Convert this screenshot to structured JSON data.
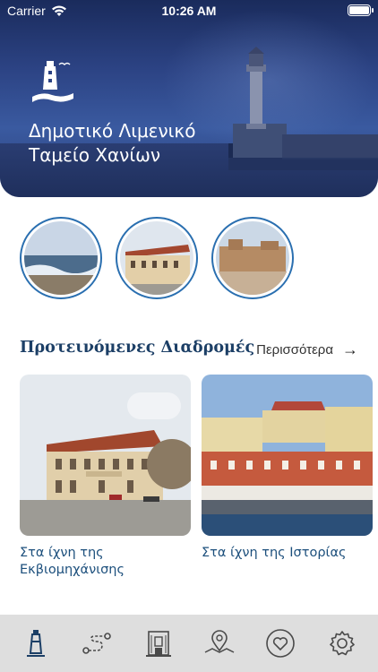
{
  "status_bar": {
    "carrier": "Carrier",
    "time": "10:26 AM"
  },
  "hero": {
    "title_line1": "Δημοτικό Λιμενικό",
    "title_line2": "Ταμείο Χανίων"
  },
  "circles": [
    {
      "name": "harbor-waves-photo"
    },
    {
      "name": "building-photo"
    },
    {
      "name": "ruins-photo"
    }
  ],
  "suggested": {
    "title": "Προτεινόμενες Διαδρομές",
    "more_label": "Περισσότερα",
    "cards": [
      {
        "label": "Στα ίχνη της Εκβιομηχάνισης"
      },
      {
        "label": "Στα ίχνη της Ιστορίας"
      }
    ]
  },
  "tabs": [
    {
      "icon": "lighthouse-icon"
    },
    {
      "icon": "route-icon"
    },
    {
      "icon": "building-icon"
    },
    {
      "icon": "map-pin-icon"
    },
    {
      "icon": "heart-icon"
    },
    {
      "icon": "gear-icon"
    }
  ],
  "colors": {
    "accent": "#1c3f66",
    "circle_border": "#2a6fb0",
    "tabbar": "#dedede"
  }
}
